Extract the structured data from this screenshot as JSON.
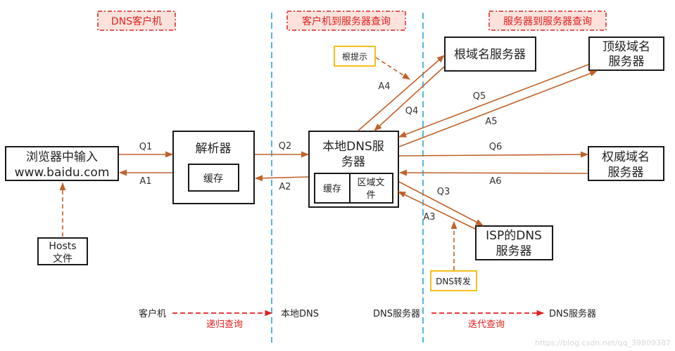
{
  "headers": {
    "client": "DNS客户机",
    "client_to_server": "客户机到服务器查询",
    "server_to_server": "服务器到服务器查询"
  },
  "nodes": {
    "browser": {
      "line1": "浏览器中输入",
      "line2": "www.baidu.com"
    },
    "hosts": {
      "line1": "Hosts",
      "line2": "文件"
    },
    "resolver": {
      "title": "解析器",
      "cache": "缓存"
    },
    "local_dns": {
      "line1": "本地DNS服",
      "line2": "务器",
      "cache": "缓存",
      "zone_line1": "区域文",
      "zone_line2": "件"
    },
    "root": {
      "label": "根域名服务器"
    },
    "tld": {
      "line1": "顶级域名",
      "line2": "服务器"
    },
    "authoritative": {
      "line1": "权威域名",
      "line2": "服务器"
    },
    "isp": {
      "line1": "ISP的DNS",
      "line2": "服务器"
    }
  },
  "notes": {
    "root_hints": "根提示",
    "dns_forward": "DNS转发"
  },
  "edges": {
    "q1": "Q1",
    "a1": "A1",
    "q2": "Q2",
    "a2": "A2",
    "q3": "Q3",
    "a3": "A3",
    "q4": "Q4",
    "a4": "A4",
    "q5": "Q5",
    "a5": "A5",
    "q6": "Q6",
    "a6": "A6"
  },
  "legend": {
    "recursive": {
      "from": "客户机",
      "to": "本地DNS",
      "label": "递归查询"
    },
    "iterative": {
      "from": "DNS服务器",
      "to": "DNS服务器",
      "label": "迭代查询"
    }
  },
  "watermark": "https://blog.csdn.net/qq_39809387",
  "colors": {
    "arrow": "#c0622a",
    "divider": "#2ea3d6",
    "header_text": "#e02020",
    "header_fill": "#fbe3dc",
    "note_border": "#f5b800"
  }
}
